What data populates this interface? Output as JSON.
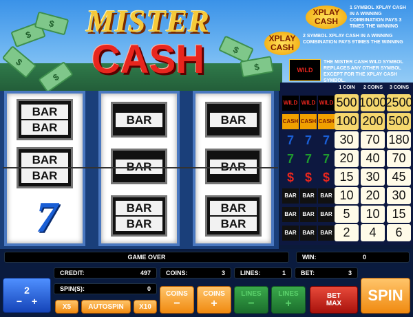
{
  "logo": {
    "line1": "MISTER",
    "line2": "CASH"
  },
  "info": {
    "xplay_word1": "XPLAY",
    "xplay_word2": "CASH",
    "rule1": "1 SYMBOL  XPLAY CASH IN A WINNING COMBINATION PAYS 3 TIMES THE WINNING",
    "rule2": "2 SYMBOL  XPLAY CASH IN A WINNING COMBINATION PAYS 9TIMES THE WINNING",
    "rule3": "THE  MISTER CASH WILD SYMBOL  REPLACES ANY OTHER  SYMBOL EXCEPT FOR THE  XPLAY CASH SYMBOL.",
    "wild_label": "WILD"
  },
  "reels": {
    "bar": "BAR",
    "seven": "7"
  },
  "paytable": {
    "headers": [
      "1 COIN",
      "2 COINS",
      "3 COINS"
    ],
    "rows": [
      {
        "symbol": "mister-cash-wild",
        "values": [
          "500",
          "1000",
          "2500"
        ]
      },
      {
        "symbol": "xplay-cash",
        "values": [
          "100",
          "200",
          "500"
        ]
      },
      {
        "symbol": "blue-seven",
        "values": [
          "30",
          "70",
          "180"
        ]
      },
      {
        "symbol": "green-seven",
        "values": [
          "20",
          "40",
          "70"
        ]
      },
      {
        "symbol": "red-dollar",
        "values": [
          "15",
          "30",
          "45"
        ]
      },
      {
        "symbol": "triple-bar",
        "values": [
          "10",
          "20",
          "30"
        ]
      },
      {
        "symbol": "double-bar",
        "values": [
          "5",
          "10",
          "15"
        ]
      },
      {
        "symbol": "single-bar",
        "values": [
          "2",
          "4",
          "6"
        ]
      }
    ],
    "highlight_color": "#f5d76e"
  },
  "status": {
    "message": "GAME OVER",
    "win_label": "WIN:",
    "win_value": "0",
    "credit_label": "CREDIT:",
    "credit_value": "497",
    "coins_label": "COINS:",
    "coins_value": "3",
    "lines_label": "LINES:",
    "lines_value": "1",
    "bet_label": "BET:",
    "bet_value": "3",
    "spins_label": "SPIN(S):",
    "spins_value": "0"
  },
  "controls": {
    "spin_count": "2",
    "minus": "−",
    "plus": "+",
    "x5": "X5",
    "autospin": "AUTOSPIN",
    "x10": "X10",
    "coins_minus_label": "COINS",
    "coins_minus_sign": "−",
    "coins_plus_label": "COINS",
    "coins_plus_sign": "+",
    "lines_minus_label": "LINES",
    "lines_minus_sign": "−",
    "lines_plus_label": "LINES",
    "lines_plus_sign": "+",
    "bet_max_line1": "BET",
    "bet_max_line2": "MAX",
    "spin_label": "SPIN"
  }
}
